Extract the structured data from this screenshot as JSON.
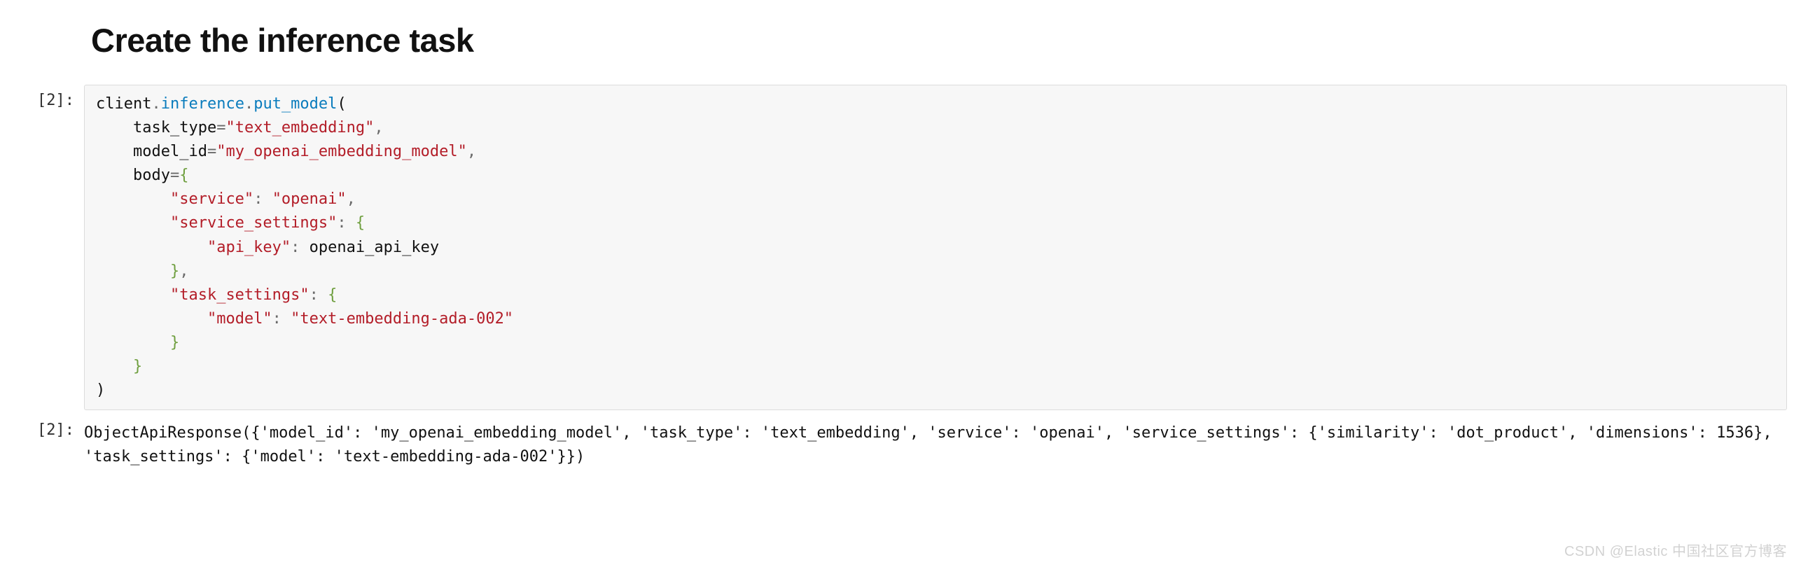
{
  "heading": "Create the inference task",
  "cells": {
    "input_prompt": "[2]:",
    "output_prompt": "[2]:"
  },
  "code": {
    "l1_client": "client",
    "l1_dot1": ".",
    "l1_inference": "inference",
    "l1_dot2": ".",
    "l1_put_model": "put_model",
    "l1_open": "(",
    "l2_indent": "    ",
    "l2_kw": "task_type",
    "l2_eq": "=",
    "l2_val": "\"text_embedding\"",
    "l2_comma": ",",
    "l3_kw": "model_id",
    "l3_eq": "=",
    "l3_val": "\"my_openai_embedding_model\"",
    "l3_comma": ",",
    "l4_kw": "body",
    "l4_eq": "=",
    "l4_brace": "{",
    "l5_indent": "        ",
    "l5_key": "\"service\"",
    "l5_colon": ": ",
    "l5_val": "\"openai\"",
    "l5_comma": ",",
    "l6_key": "\"service_settings\"",
    "l6_colon": ": ",
    "l6_brace": "{",
    "l7_indent": "            ",
    "l7_key": "\"api_key\"",
    "l7_colon": ": ",
    "l7_val": "openai_api_key",
    "l8_indent": "        ",
    "l8_brace": "}",
    "l8_comma": ",",
    "l9_key": "\"task_settings\"",
    "l9_colon": ": ",
    "l9_brace": "{",
    "l10_indent": "            ",
    "l10_key": "\"model\"",
    "l10_colon": ": ",
    "l10_val": "\"text-embedding-ada-002\"",
    "l11_indent": "        ",
    "l11_brace": "}",
    "l12_indent": "    ",
    "l12_brace": "}",
    "l13_close": ")"
  },
  "output_text": "ObjectApiResponse({'model_id': 'my_openai_embedding_model', 'task_type': 'text_embedding', 'service': 'openai', 'service_settings': {'similarity': 'dot_product', 'dimensions': 1536}, 'task_settings': {'model': 'text-embedding-ada-002'}})",
  "watermark": "CSDN @Elastic 中国社区官方博客"
}
